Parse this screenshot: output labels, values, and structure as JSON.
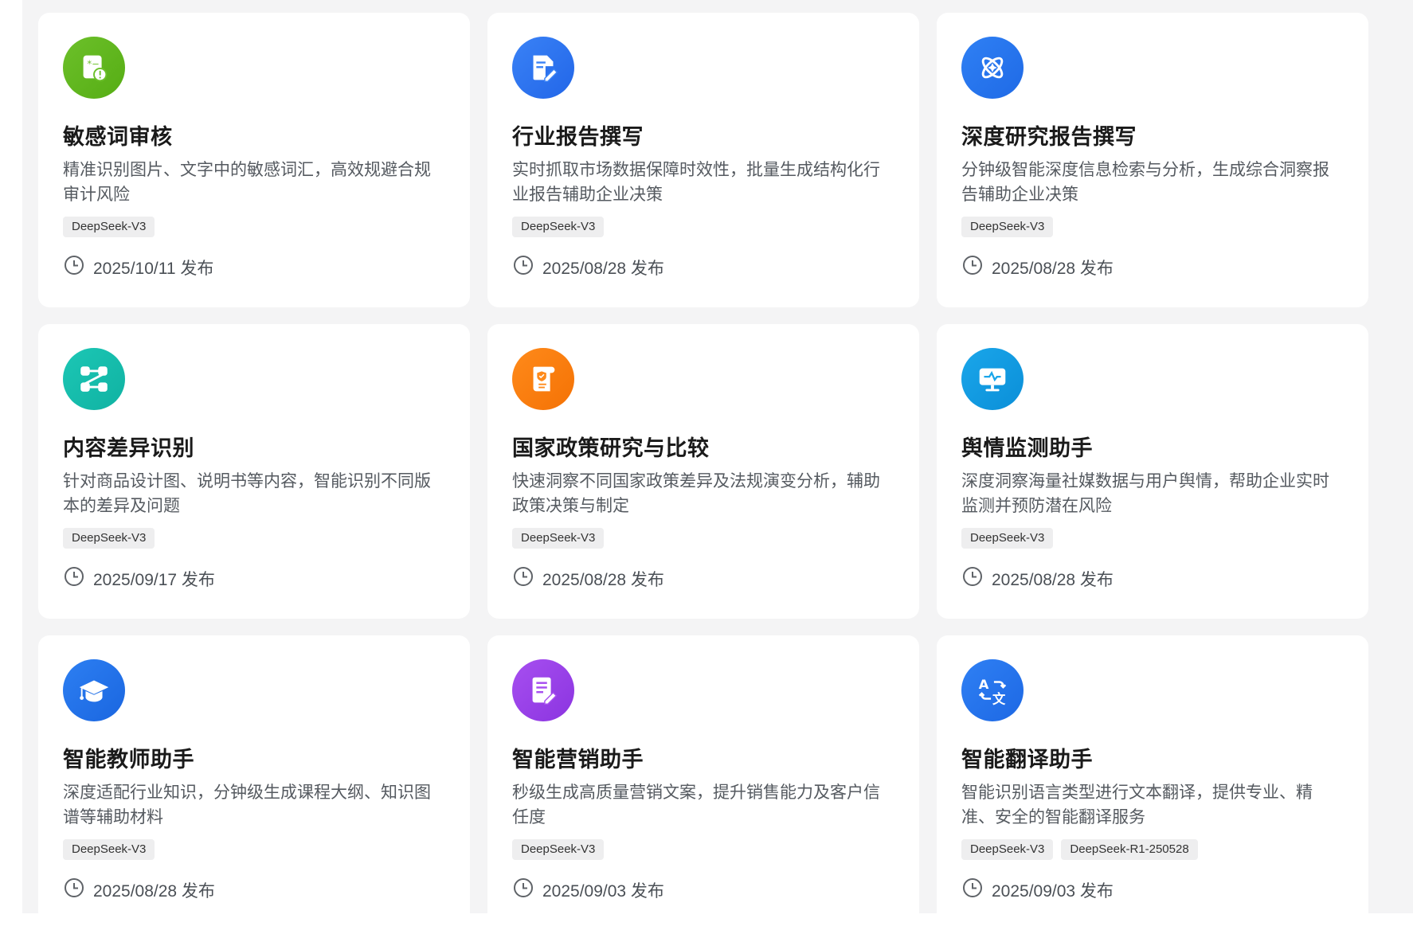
{
  "cards": [
    {
      "title": "敏感词审核",
      "desc": "精准识别图片、文字中的敏感词汇，高效规避合规审计风险",
      "tags": [
        "DeepSeek-V3"
      ],
      "date": "2025/10/11 发布",
      "icon": "sensitive-audit-icon",
      "color": "#6cc02a",
      "color2": "#56ad14"
    },
    {
      "title": "行业报告撰写",
      "desc": "实时抓取市场数据保障时效性，批量生成结构化行业报告辅助企业决策",
      "tags": [
        "DeepSeek-V3"
      ],
      "date": "2025/08/28 发布",
      "icon": "document-edit-icon",
      "color": "#3a82f6",
      "color2": "#2266e8"
    },
    {
      "title": "深度研究报告撰写",
      "desc": "分钟级智能深度信息检索与分析，生成综合洞察报告辅助企业决策",
      "tags": [
        "DeepSeek-V3"
      ],
      "date": "2025/08/28 发布",
      "icon": "atom-icon",
      "color": "#2f80f4",
      "color2": "#1f6ae6"
    },
    {
      "title": "内容差异识别",
      "desc": "针对商品设计图、说明书等内容，智能识别不同版本的差异及问题",
      "tags": [
        "DeepSeek-V3"
      ],
      "date": "2025/09/17 发布",
      "icon": "flow-compare-icon",
      "color": "#1cc7b5",
      "color2": "#10b2a2"
    },
    {
      "title": "国家政策研究与比较",
      "desc": "快速洞察不同国家政策差异及法规演变分析，辅助政策决策与制定",
      "tags": [
        "DeepSeek-V3"
      ],
      "date": "2025/08/28 发布",
      "icon": "policy-scroll-icon",
      "color": "#ff8a1a",
      "color2": "#f47205"
    },
    {
      "title": "舆情监测助手",
      "desc": "深度洞察海量社媒数据与用户舆情，帮助企业实时监测并预防潜在风险",
      "tags": [
        "DeepSeek-V3"
      ],
      "date": "2025/08/28 发布",
      "icon": "monitor-pulse-icon",
      "color": "#1aa6ea",
      "color2": "#0b8fd8"
    },
    {
      "title": "智能教师助手",
      "desc": "深度适配行业知识，分钟级生成课程大纲、知识图谱等辅助材料",
      "tags": [
        "DeepSeek-V3"
      ],
      "date": "2025/08/28 发布",
      "icon": "graduation-cap-icon",
      "color": "#2d7ff2",
      "color2": "#1a66e0"
    },
    {
      "title": "智能营销助手",
      "desc": "秒级生成高质量营销文案，提升销售能力及客户信任度",
      "tags": [
        "DeepSeek-V3"
      ],
      "date": "2025/09/03 发布",
      "icon": "note-edit-icon",
      "color": "#a74ff0",
      "color2": "#8b34e0"
    },
    {
      "title": "智能翻译助手",
      "desc": "智能识别语言类型进行文本翻译，提供专业、精准、安全的智能翻译服务",
      "tags": [
        "DeepSeek-V3",
        "DeepSeek-R1-250528"
      ],
      "date": "2025/09/03 发布",
      "icon": "translate-icon",
      "color": "#2f80f4",
      "color2": "#1d68e4"
    }
  ]
}
